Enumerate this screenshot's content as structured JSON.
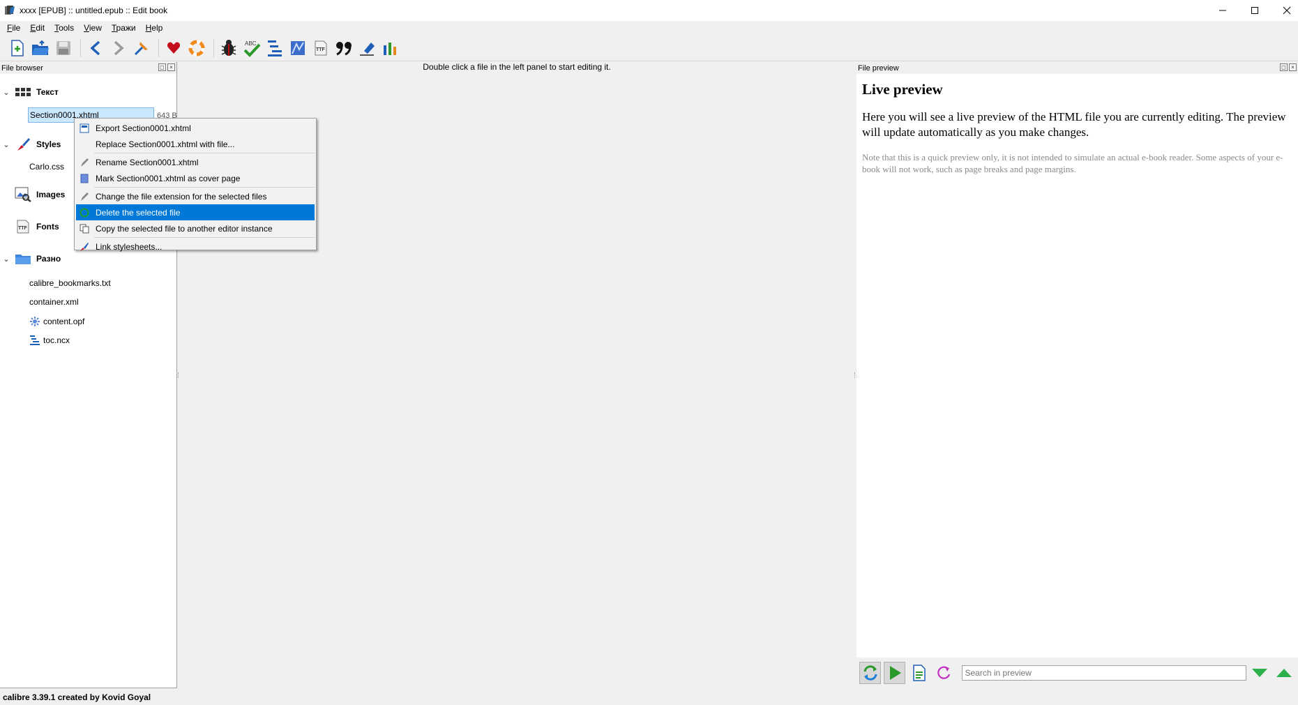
{
  "window": {
    "title": "xxxx [EPUB] :: untitled.epub :: Edit book"
  },
  "menu": [
    {
      "label": "File",
      "accel": "F",
      "rest": "ile"
    },
    {
      "label": "Edit",
      "accel": "E",
      "rest": "dit"
    },
    {
      "label": "Tools",
      "accel": "T",
      "rest": "ools"
    },
    {
      "label": "View",
      "accel": "V",
      "rest": "iew"
    },
    {
      "label": "Тражи",
      "accel": "Т",
      "rest": "ражи"
    },
    {
      "label": "Help",
      "accel": "H",
      "rest": "elp"
    }
  ],
  "toolbar": {
    "icons": [
      "new-file-icon",
      "open-book-icon",
      "save-icon",
      "back-icon",
      "forward-icon",
      "checkpoint-icon",
      "favorite-icon",
      "donate-icon",
      "check-book-icon",
      "spell-check-icon",
      "toc-icon",
      "reports-icon",
      "fonts-icon",
      "smarten-quotes-icon",
      "insert-tag-icon",
      "statistics-icon"
    ]
  },
  "file_browser": {
    "title": "File browser",
    "categories": {
      "text": {
        "label": "Текст"
      },
      "styles": {
        "label": "Styles"
      },
      "images": {
        "label": "Images"
      },
      "fonts": {
        "label": "Fonts"
      },
      "misc": {
        "label": "Разно"
      }
    },
    "selected_file": {
      "name": "Section0001.xhtml",
      "size": "643 B"
    },
    "style_files": [
      "Carlo.css"
    ],
    "misc_files": [
      "calibre_bookmarks.txt",
      "container.xml",
      "content.opf",
      "toc.ncx"
    ]
  },
  "context_menu": {
    "export": "Export Section0001.xhtml",
    "replace": "Replace Section0001.xhtml with file...",
    "rename": "Rename Section0001.xhtml",
    "cover": "Mark Section0001.xhtml as cover page",
    "change_ext": "Change the file extension for the selected files",
    "delete": "Delete the selected file",
    "copy": "Copy the selected file to another editor instance",
    "link": "Link stylesheets..."
  },
  "editor": {
    "hint": "Double click a file in the left panel to start editing it."
  },
  "preview": {
    "title": "File preview",
    "heading": "Live preview",
    "main_text": "Here you will see a live preview of the HTML file you are currently editing. The preview will update automatically as you make changes.",
    "note_text": "Note that this is a quick preview only, it is not intended to simulate an actual e-book reader. Some aspects of your e-book will not work, such as page breaks and page margins.",
    "search_placeholder": "Search in preview"
  },
  "status": {
    "text": "calibre 3.39.1 created by Kovid Goyal"
  },
  "colors": {
    "highlight": "#0078d7",
    "selection": "#cce8ff"
  }
}
